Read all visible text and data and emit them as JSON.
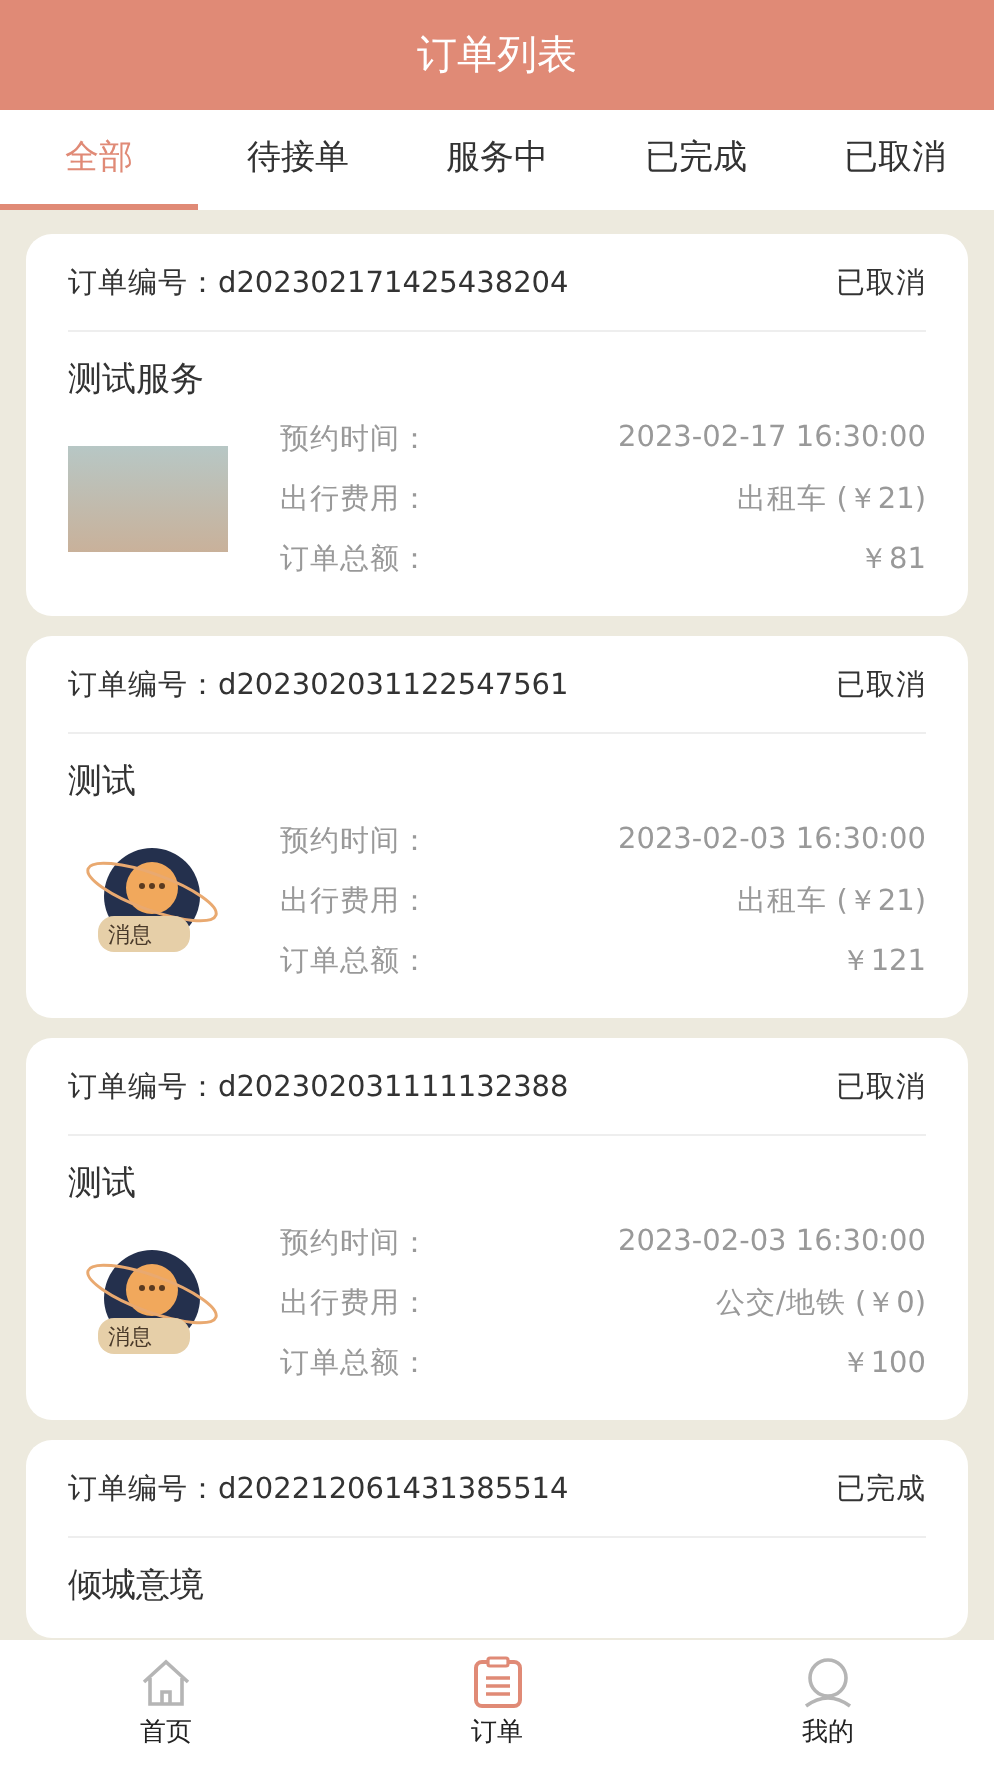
{
  "header": {
    "title": "订单列表"
  },
  "tabs": [
    {
      "label": "全部",
      "selected": true
    },
    {
      "label": "待接单",
      "selected": false
    },
    {
      "label": "服务中",
      "selected": false
    },
    {
      "label": "已完成",
      "selected": false
    },
    {
      "label": "已取消",
      "selected": false
    }
  ],
  "orders": [
    {
      "order_label": "订单编号：",
      "order_no": "d202302171425438204",
      "status": "已取消",
      "title": "测试服务",
      "image": {
        "kind": "photo"
      },
      "details": [
        {
          "label": "预约时间：",
          "value": "2023-02-17 16:30:00"
        },
        {
          "label": "出行费用：",
          "value": "出租车 (￥21)"
        },
        {
          "label": "订单总额：",
          "value": "￥81"
        }
      ]
    },
    {
      "order_label": "订单编号：",
      "order_no": "d202302031122547561",
      "status": "已取消",
      "title": "测试",
      "image": {
        "kind": "message",
        "label": "消息"
      },
      "details": [
        {
          "label": "预约时间：",
          "value": "2023-02-03 16:30:00"
        },
        {
          "label": "出行费用：",
          "value": "出租车 (￥21)"
        },
        {
          "label": "订单总额：",
          "value": "￥121"
        }
      ]
    },
    {
      "order_label": "订单编号：",
      "order_no": "d202302031111132388",
      "status": "已取消",
      "title": "测试",
      "image": {
        "kind": "message",
        "label": "消息"
      },
      "details": [
        {
          "label": "预约时间：",
          "value": "2023-02-03 16:30:00"
        },
        {
          "label": "出行费用：",
          "value": "公交/地铁 (￥0)"
        },
        {
          "label": "订单总额：",
          "value": "￥100"
        }
      ]
    },
    {
      "order_label": "订单编号：",
      "order_no": "d202212061431385514",
      "status": "已完成",
      "title": "倾城意境"
    }
  ],
  "bottom_nav": [
    {
      "label": "首页",
      "kind": "home",
      "selected": false
    },
    {
      "label": "订单",
      "kind": "orders",
      "selected": true
    },
    {
      "label": "我的",
      "kind": "profile",
      "selected": false
    }
  ]
}
